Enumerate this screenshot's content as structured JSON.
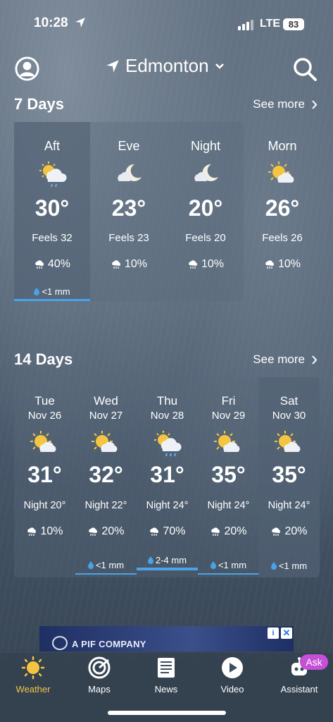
{
  "status": {
    "time": "10:28",
    "network": "LTE",
    "battery": "83"
  },
  "header": {
    "city": "Edmonton"
  },
  "seven_days": {
    "title": "7 Days",
    "see_more": "See more",
    "items": [
      {
        "label": "Aft",
        "icon": "partly-sunny-rain-icon",
        "temp": "30°",
        "feels": "Feels 32",
        "precip": "40%",
        "rain": "<1 mm"
      },
      {
        "label": "Eve",
        "icon": "moon-cloud-icon",
        "temp": "23°",
        "feels": "Feels 23",
        "precip": "10%"
      },
      {
        "label": "Night",
        "icon": "moon-cloud-icon",
        "temp": "20°",
        "feels": "Feels 20",
        "precip": "10%"
      },
      {
        "label": "Morn",
        "icon": "partly-sunny-icon",
        "temp": "26°",
        "feels": "Feels 26",
        "precip": "10%"
      }
    ]
  },
  "fourteen_days": {
    "title": "14 Days",
    "see_more": "See more",
    "items": [
      {
        "day": "Tue",
        "date": "Nov 26",
        "icon": "partly-sunny-icon",
        "temp": "31°",
        "night": "Night 20°",
        "precip": "10%",
        "rain": ""
      },
      {
        "day": "Wed",
        "date": "Nov 27",
        "icon": "partly-sunny-icon",
        "temp": "32°",
        "night": "Night 22°",
        "precip": "20%",
        "rain": "<1 mm"
      },
      {
        "day": "Thu",
        "date": "Nov 28",
        "icon": "partly-sunny-rain-icon",
        "temp": "31°",
        "night": "Night 24°",
        "precip": "70%",
        "rain": "2-4 mm"
      },
      {
        "day": "Fri",
        "date": "Nov 29",
        "icon": "partly-sunny-icon",
        "temp": "35°",
        "night": "Night 24°",
        "precip": "20%",
        "rain": "<1 mm"
      },
      {
        "day": "Sat",
        "date": "Nov 30",
        "icon": "partly-sunny-icon",
        "temp": "35°",
        "night": "Night 24°",
        "precip": "20%",
        "rain": "<1 mm"
      }
    ]
  },
  "ad": {
    "text": "A PIF COMPANY",
    "info": "i",
    "close": "✕"
  },
  "tabs": [
    {
      "label": "Weather",
      "icon": "sun-icon",
      "active": true
    },
    {
      "label": "Maps",
      "icon": "radar-icon"
    },
    {
      "label": "News",
      "icon": "newspaper-icon"
    },
    {
      "label": "Video",
      "icon": "play-icon"
    },
    {
      "label": "Assistant",
      "icon": "robot-icon"
    }
  ],
  "ask_badge": "Ask",
  "colors": {
    "accent": "#f5c542",
    "rain_bar": "#4aa3e8",
    "ask_badge": "#c64fd8"
  }
}
